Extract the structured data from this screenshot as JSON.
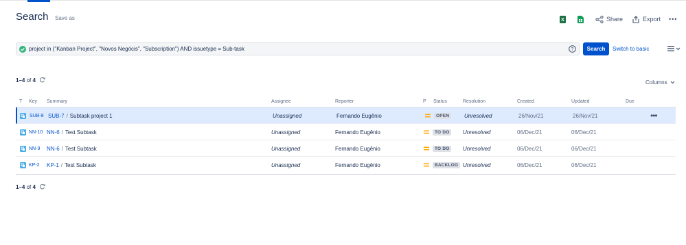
{
  "header": {
    "title": "Search",
    "save_as": "Save as",
    "share_label": "Share",
    "export_label": "Export",
    "more_label": "•••"
  },
  "search": {
    "jql": "project in (\"Kanban Project\", \"Novos Negócis\", \"Subscription\") AND issuetype = Sub-task",
    "button_label": "Search",
    "switch_label": "Switch to basic"
  },
  "results": {
    "range": "1–4",
    "of_label": "of",
    "total": "4",
    "columns_label": "Columns"
  },
  "columns": [
    "T",
    "Key",
    "Summary",
    "Assignee",
    "Reporter",
    "P",
    "Status",
    "Resolution",
    "Created",
    "Updated",
    "Due"
  ],
  "rows": [
    {
      "key": "SUB-8",
      "parent": "SUB-7",
      "sep": "/",
      "summary": "Subtask project 1",
      "assignee": "Unassigned",
      "reporter": "Fernando Eugênio",
      "status": "OPEN",
      "resolution": "Unresolved",
      "created": "26/Nov/21",
      "updated": "26/Nov/21",
      "due": "",
      "actions": "•••"
    },
    {
      "key": "NN-10",
      "parent": "NN-6",
      "sep": "/",
      "summary": "Test Subtask",
      "assignee": "Unassigned",
      "reporter": "Fernando Eugênio",
      "status": "TO DO",
      "resolution": "Unresolved",
      "created": "06/Dec/21",
      "updated": "06/Dec/21",
      "due": ""
    },
    {
      "key": "NN-9",
      "parent": "NN-6",
      "sep": "/",
      "summary": "Test Subtask",
      "assignee": "Unassigned",
      "reporter": "Fernando Eugênio",
      "status": "TO DO",
      "resolution": "Unresolved",
      "created": "06/Dec/21",
      "updated": "06/Dec/21",
      "due": ""
    },
    {
      "key": "KP-2",
      "parent": "KP-1",
      "sep": "/",
      "summary": "Test Subtask",
      "assignee": "Unassigned",
      "reporter": "Fernando Eugênio",
      "status": "BACKLOG",
      "resolution": "Unresolved",
      "created": "06/Dec/21",
      "updated": "06/Dec/21",
      "due": ""
    }
  ],
  "icons": {
    "subtask": "subtask-icon",
    "priority": "priority-medium-icon",
    "excel": "excel-icon",
    "sheets": "google-sheets-icon",
    "share": "share-icon",
    "export": "export-icon",
    "refresh": "refresh-icon",
    "help": "help-icon",
    "valid": "check-circle-icon",
    "menu": "list-view-icon"
  },
  "colors": {
    "accent": "#0052cc",
    "selected_row": "#deebff",
    "priority_medium": "#ffab00",
    "valid_green": "#36b37e",
    "excel_green": "#1e7145",
    "sheets_green": "#0f9d58",
    "subtask_blue": "#4bade8"
  }
}
